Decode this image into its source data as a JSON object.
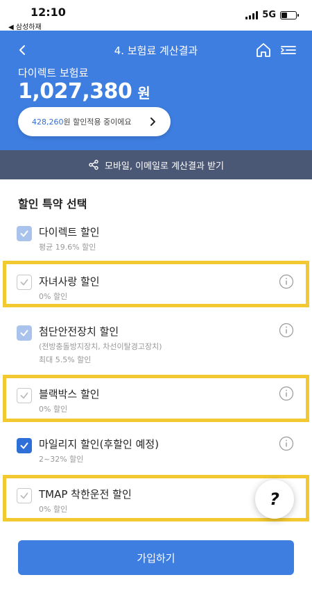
{
  "status": {
    "time": "12:10",
    "back_app": "◀ 삼성하재",
    "network": "5G",
    "battery_level": 0.4
  },
  "header": {
    "title": "4. 보험료 계산결과",
    "premium_label": "다이렉트 보험료",
    "premium_amount": "1,027,380",
    "premium_unit": "원",
    "discount_amount": "428,260",
    "discount_text": "원 할인적용 중이에요"
  },
  "share": {
    "label": "모바일, 이메일로 계산결과 받기"
  },
  "section": {
    "title": "할인 특약 선택"
  },
  "items": [
    {
      "label": "다이렉트 할인",
      "sub": "평균 19.6% 할인"
    },
    {
      "label": "자녀사랑 할인",
      "sub": "0% 할인"
    },
    {
      "label": "첨단안전장치 할인",
      "sub": "(전방충돌방지장치, 차선이탈경고장치)",
      "sub2": "최대 5.5% 할인"
    },
    {
      "label": "블랙박스 할인",
      "sub": "0% 할인"
    },
    {
      "label": "마일리지 할인(후할인 예정)",
      "sub": "2~32% 할인"
    },
    {
      "label": "TMAP 착한운전 할인",
      "sub": "0% 할인"
    }
  ],
  "help": {
    "label": "?"
  },
  "footer": {
    "join_label": "가입하기"
  },
  "colors": {
    "primary": "#3e7ee0",
    "share_bar": "#4a5875",
    "highlight": "#f3c931"
  }
}
